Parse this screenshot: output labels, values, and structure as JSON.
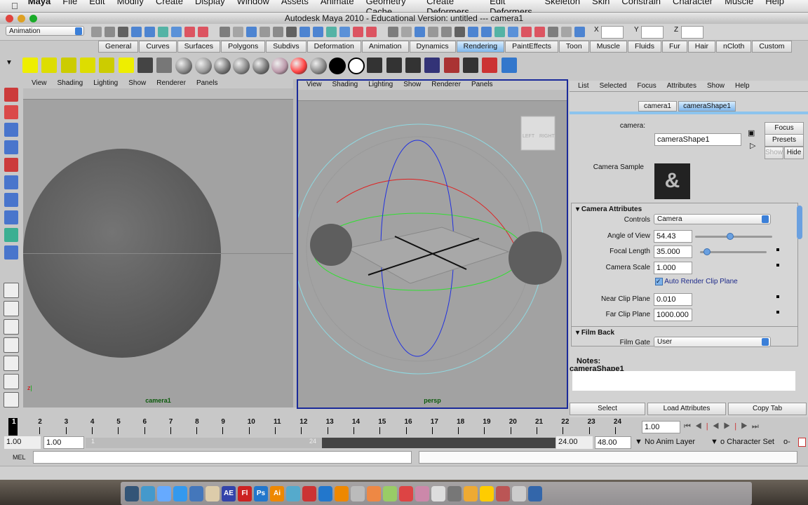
{
  "mac_menu": [
    "Maya",
    "File",
    "Edit",
    "Modify",
    "Create",
    "Display",
    "Window",
    "Assets",
    "Animate",
    "Geometry Cache",
    "Create Deformers",
    "Edit Deformers",
    "Skeleton",
    "Skin",
    "Constrain",
    "Character",
    "Muscle",
    "Help"
  ],
  "window_title": "Autodesk Maya 2010 - Educational Version: untitled   ---   camera1",
  "status_line": {
    "menu_set": "Animation",
    "x_label": "X",
    "y_label": "Y",
    "z_label": "Z"
  },
  "shelf_tabs": [
    "General",
    "Curves",
    "Surfaces",
    "Polygons",
    "Subdivs",
    "Deformation",
    "Animation",
    "Dynamics",
    "Rendering",
    "PaintEffects",
    "Toon",
    "Muscle",
    "Fluids",
    "Fur",
    "Hair",
    "nCloth",
    "Custom"
  ],
  "active_shelf": "Rendering",
  "panel_menu": [
    "View",
    "Shading",
    "Lighting",
    "Show",
    "Renderer",
    "Panels"
  ],
  "viewports": [
    {
      "label": "camera1"
    },
    {
      "label": "persp"
    }
  ],
  "viewcube": {
    "left": "LEFT",
    "right": "RIGHT"
  },
  "attribute_editor": {
    "menu": [
      "List",
      "Selected",
      "Focus",
      "Attributes",
      "Show",
      "Help"
    ],
    "tabs": [
      "camera1",
      "cameraShape1"
    ],
    "node_label": "camera:",
    "node_name": "cameraShape1",
    "buttons": {
      "focus": "Focus",
      "presets": "Presets",
      "show": "Show",
      "hide": "Hide"
    },
    "sample_label": "Camera Sample",
    "section_camera": "Camera Attributes",
    "controls_label": "Controls",
    "controls_value": "Camera",
    "aov_label": "Angle of View",
    "aov_value": "54.43",
    "aov_slider": 0.45,
    "focal_label": "Focal Length",
    "focal_value": "35.000",
    "focal_slider": 0.05,
    "scale_label": "Camera Scale",
    "scale_value": "1.000",
    "auto_clip_label": "Auto Render Clip Plane",
    "auto_clip_checked": true,
    "near_label": "Near Clip Plane",
    "near_value": "0.010",
    "far_label": "Far Clip Plane",
    "far_value": "1000.000",
    "section_film": "Film Back",
    "film_gate_label": "Film Gate",
    "film_gate_value": "User",
    "notes_label": "Notes:",
    "notes_node": "cameraShape1",
    "bottom_buttons": [
      "Select",
      "Load Attributes",
      "Copy Tab"
    ]
  },
  "timeline": {
    "frames": [
      1,
      2,
      3,
      4,
      5,
      6,
      7,
      8,
      9,
      10,
      11,
      12,
      13,
      14,
      15,
      16,
      17,
      18,
      19,
      20,
      21,
      22,
      23,
      24
    ],
    "current_frame": "1.00"
  },
  "range": {
    "start": "1.00",
    "playback_start": "1.00",
    "slider_start": "1",
    "slider_end": "24",
    "playback_end": "24.00",
    "end": "48.00",
    "anim_layer": "No Anim Layer",
    "character_set": "o Character Set"
  },
  "command_line": {
    "label": "MEL"
  },
  "dock_apps": [
    "AE",
    "Fl",
    "Ps",
    "Ai"
  ]
}
